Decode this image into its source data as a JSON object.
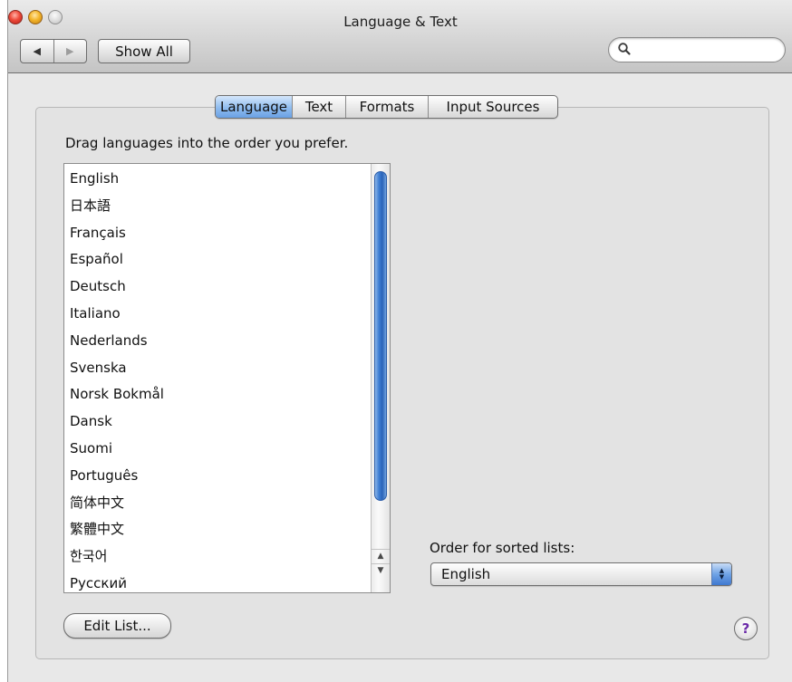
{
  "window": {
    "title": "Language & Text"
  },
  "toolbar": {
    "back_icon": "left-triangle",
    "forward_icon": "right-triangle",
    "show_all_label": "Show All",
    "search": {
      "placeholder": "",
      "value": "",
      "icon": "magnifier-icon"
    }
  },
  "tabs": [
    {
      "label": "Language",
      "active": true
    },
    {
      "label": "Text",
      "active": false
    },
    {
      "label": "Formats",
      "active": false
    },
    {
      "label": "Input Sources",
      "active": false
    }
  ],
  "language_pane": {
    "instructions": "Drag languages into the order you prefer.",
    "languages": [
      "English",
      "日本語",
      "Français",
      "Español",
      "Deutsch",
      "Italiano",
      "Nederlands",
      "Svenska",
      "Norsk Bokmål",
      "Dansk",
      "Suomi",
      "Português",
      "简体中文",
      "繁體中文",
      "한국어",
      "Русский"
    ],
    "sorted_lists_label": "Order for sorted lists:",
    "sorted_lists_value": "English",
    "edit_list_label": "Edit List...",
    "help_label": "?"
  },
  "colors": {
    "selected_tab": "#6aa1e4",
    "help_glyph": "#6a2aa8",
    "scroll_thumb": "#3f7fd4"
  }
}
